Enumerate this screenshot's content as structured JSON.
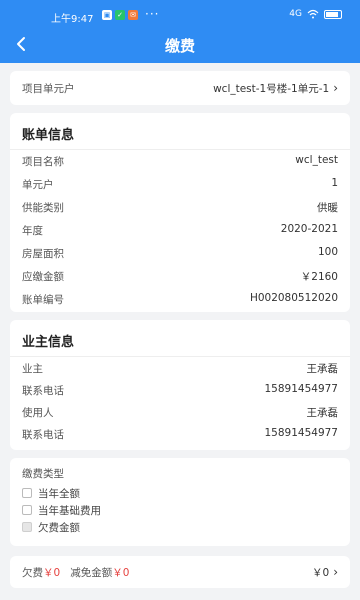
{
  "status_bar": {
    "time": "上午9:47",
    "right_text": "4G"
  },
  "header": {
    "title": "缴费",
    "back_icon": "chevron-left-icon"
  },
  "unit_selector": {
    "label": "项目单元户",
    "value": "wcl_test-1号楼-1单元-1"
  },
  "bill_info": {
    "title": "账单信息",
    "rows": [
      {
        "label": "项目名称",
        "value": "wcl_test"
      },
      {
        "label": "单元户",
        "value": "1"
      },
      {
        "label": "供能类别",
        "value": "供暖"
      },
      {
        "label": "年度",
        "value": "2020-2021"
      },
      {
        "label": "房屋面积",
        "value": "100"
      },
      {
        "label": "应缴金额",
        "value": "￥2160"
      },
      {
        "label": "账单编号",
        "value": "H002080512020"
      }
    ]
  },
  "owner_info": {
    "title": "业主信息",
    "rows": [
      {
        "label": "业主",
        "value": "王承磊"
      },
      {
        "label": "联系电话",
        "value": "15891454977"
      },
      {
        "label": "使用人",
        "value": "王承磊"
      },
      {
        "label": "联系电话",
        "value": "15891454977"
      }
    ]
  },
  "payment_type": {
    "title": "缴费类型",
    "options": [
      {
        "label": "当年全额",
        "disabled": false
      },
      {
        "label": "当年基础费用",
        "disabled": false
      },
      {
        "label": "欠费金额",
        "disabled": true
      }
    ]
  },
  "footer": {
    "arrears_label": "欠费",
    "arrears_value": "￥0",
    "waiver_label": "减免金额",
    "waiver_value": "￥0",
    "total_value": "￥0"
  },
  "colors": {
    "primary": "#2f8cf3",
    "accent_red": "#e64340",
    "background": "#f2f3f5"
  }
}
